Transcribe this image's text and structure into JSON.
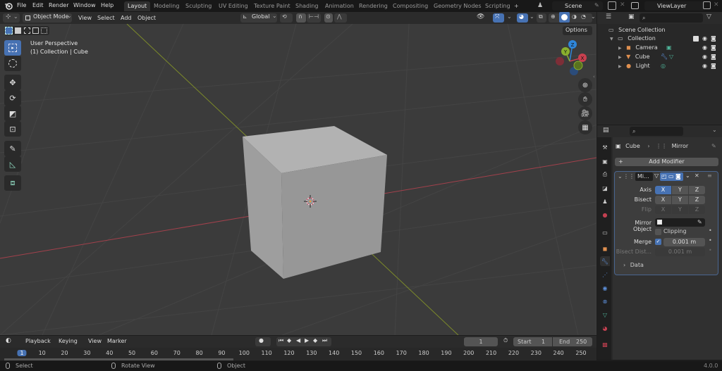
{
  "topbar": {
    "menus": [
      "File",
      "Edit",
      "Render",
      "Window",
      "Help"
    ],
    "workspaces": [
      "Layout",
      "Modeling",
      "Sculpting",
      "UV Editing",
      "Texture Paint",
      "Shading",
      "Animation",
      "Rendering",
      "Compositing",
      "Geometry Nodes",
      "Scripting"
    ],
    "active_workspace": "Layout",
    "add_workspace": "+",
    "scene": "Scene",
    "view_layer": "ViewLayer"
  },
  "viewport": {
    "mode": "Object Mode",
    "menus": [
      "View",
      "Select",
      "Add",
      "Object"
    ],
    "transform_orientation": "Global",
    "options_label": "Options",
    "overlay_title": "User Perspective",
    "overlay_subtitle": "(1) Collection | Cube",
    "gizmo_axes": {
      "x": "X",
      "y": "Y",
      "z": "Z"
    },
    "colors": {
      "x_axis": "#c9404f",
      "y_axis": "#8ab02e",
      "z_axis": "#2f86d9",
      "accent": "#4772b3"
    },
    "tools": [
      "select-box",
      "cursor",
      "move",
      "rotate",
      "scale",
      "transform",
      "annotate",
      "measure",
      "add-cube"
    ]
  },
  "outliner": {
    "root": "Scene Collection",
    "collection": "Collection",
    "objects": [
      {
        "name": "Camera"
      },
      {
        "name": "Cube"
      },
      {
        "name": "Light"
      }
    ]
  },
  "properties": {
    "breadcrumb_object": "Cube",
    "breadcrumb_modifier": "Mirror",
    "add_modifier": "Add Modifier",
    "modifier_name": "Mi...",
    "axis_label": "Axis",
    "bisect_label": "Bisect",
    "flip_label": "Flip",
    "axes": [
      "X",
      "Y",
      "Z"
    ],
    "axis_active": "X",
    "mirror_object_label": "Mirror Object",
    "clipping_label": "Clipping",
    "clipping": false,
    "merge_label": "Merge",
    "merge": true,
    "merge_value": "0.001 m",
    "bisect_dist_label": "Bisect Dist...",
    "bisect_dist_value": "0.001 m",
    "data_label": "Data"
  },
  "timeline": {
    "menus": [
      "Playback",
      "Keying",
      "View",
      "Marker"
    ],
    "current_frame": "1",
    "start_label": "Start",
    "start": "1",
    "end_label": "End",
    "end": "250",
    "ticks": [
      "1",
      "10",
      "20",
      "30",
      "40",
      "50",
      "60",
      "70",
      "80",
      "90",
      "100",
      "110",
      "120",
      "130",
      "140",
      "150",
      "160",
      "170",
      "180",
      "190",
      "200",
      "210",
      "220",
      "230",
      "240",
      "250"
    ]
  },
  "statusbar": {
    "select": "Select",
    "rotate": "Rotate View",
    "object": "Object",
    "version": "4.0.0"
  }
}
